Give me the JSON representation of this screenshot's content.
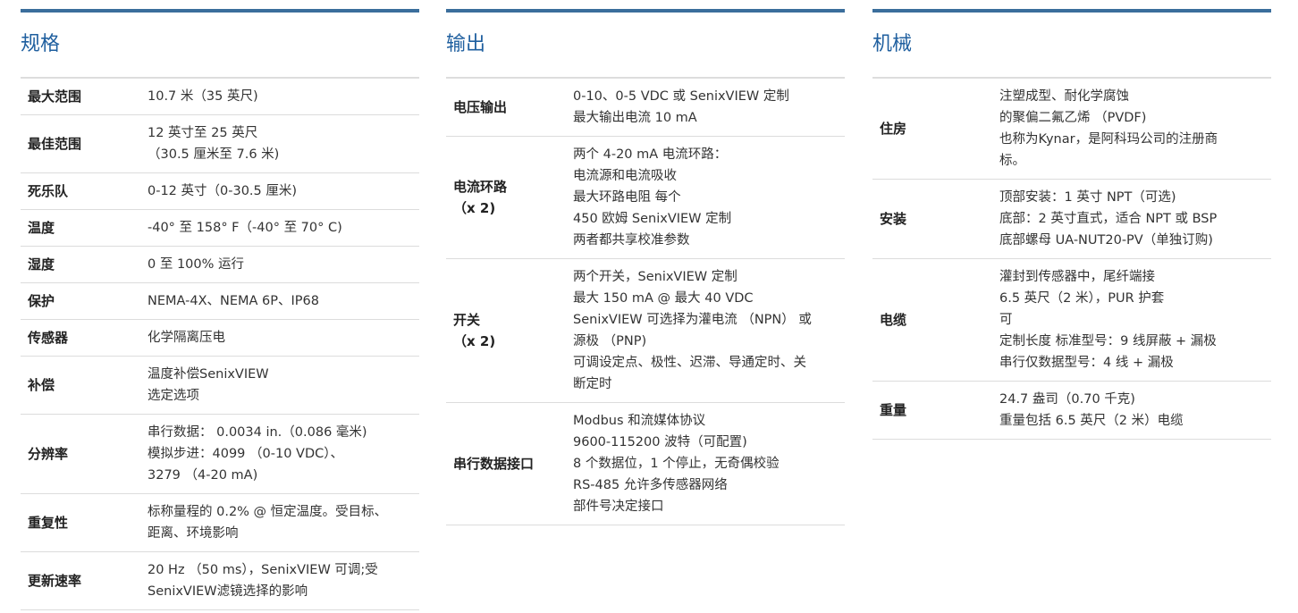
{
  "spec": {
    "title": "规格",
    "rows": [
      {
        "label": [
          "最大范围"
        ],
        "value": [
          "10.7 米（35 英尺)"
        ]
      },
      {
        "label": [
          "最佳范围"
        ],
        "value": [
          "12 英寸至 25 英尺",
          "（30.5 厘米至 7.6 米)"
        ]
      },
      {
        "label": [
          "死乐队"
        ],
        "value": [
          "0-12 英寸（0-30.5 厘米)"
        ]
      },
      {
        "label": [
          "温度"
        ],
        "value": [
          "-40° 至 158° F（-40° 至 70° C)"
        ]
      },
      {
        "label": [
          "湿度"
        ],
        "value": [
          "0 至 100% 运行"
        ]
      },
      {
        "label": [
          "保护"
        ],
        "value": [
          "NEMA-4X、NEMA 6P、IP68"
        ]
      },
      {
        "label": [
          "传感器"
        ],
        "value": [
          "化学隔离压电"
        ]
      },
      {
        "label": [
          "补偿"
        ],
        "value": [
          "温度补偿SenixVIEW",
          "选定选项"
        ]
      },
      {
        "label": [
          "分辨率"
        ],
        "value": [
          "串行数据： 0.0034 in.（0.086 毫米)",
          "模拟步进：4099 （0-10 VDC）、",
          "3279 （4-20 mA)"
        ]
      },
      {
        "label": [
          "重复性"
        ],
        "value": [
          "标称量程的 0.2% @ 恒定温度。受目标、",
          "距离、环境影响"
        ]
      },
      {
        "label": [
          "更新速率"
        ],
        "value": [
          "20 Hz （50 ms），SenixVIEW 可调;受",
          "SenixVIEW滤镜选择的影响"
        ]
      }
    ]
  },
  "output": {
    "title": "输出",
    "rows": [
      {
        "label": [
          "电压输出"
        ],
        "value": [
          "0-10、0-5 VDC 或 SenixVIEW 定制",
          "最大输出电流 10 mA"
        ]
      },
      {
        "label": [
          "电流环路",
          "（x 2)"
        ],
        "value": [
          "两个 4-20 mA 电流环路：",
          "电流源和电流吸收",
          "最大环路电阻 每个",
          "450 欧姆 SenixVIEW 定制",
          "两者都共享校准参数"
        ]
      },
      {
        "label": [
          "开关",
          "（x 2)"
        ],
        "value": [
          "两个开关，SenixVIEW 定制",
          "最大 150 mA @ 最大 40 VDC",
          "SenixVIEW 可选择为灌电流 （NPN） 或",
          "源极 （PNP)",
          "可调设定点、极性、迟滞、导通定时、关",
          "断定时"
        ]
      },
      {
        "label": [
          "串行数据接口"
        ],
        "value": [
          "Modbus 和流媒体协议",
          "9600-115200 波特（可配置)",
          "8 个数据位，1 个停止，无奇偶校验",
          "RS-485 允许多传感器网络",
          "部件号决定接口"
        ]
      }
    ]
  },
  "mechanical": {
    "title": "机械",
    "rows": [
      {
        "label": [
          "住房"
        ],
        "value": [
          "注塑成型、耐化学腐蚀",
          "的聚偏二氟乙烯 （PVDF)",
          "也称为Kynar，是阿科玛公司的注册商",
          "标。"
        ]
      },
      {
        "label": [
          "安装"
        ],
        "value": [
          "顶部安装：1 英寸 NPT（可选)",
          "底部：2 英寸直式，适合 NPT 或 BSP",
          "底部螺母 UA-NUT20-PV（单独订购)"
        ]
      },
      {
        "label": [
          "电缆"
        ],
        "value": [
          "灌封到传感器中，尾纤端接",
          "6.5 英尺（2 米），PUR 护套",
          "可",
          "定制长度 标准型号：9 线屏蔽 + 漏极",
          "串行仅数据型号：4 线 + 漏极"
        ]
      },
      {
        "label": [
          "重量"
        ],
        "value": [
          "24.7 盎司（0.70 千克)",
          "重量包括 6.5 英尺（2 米）电缆"
        ]
      }
    ]
  }
}
